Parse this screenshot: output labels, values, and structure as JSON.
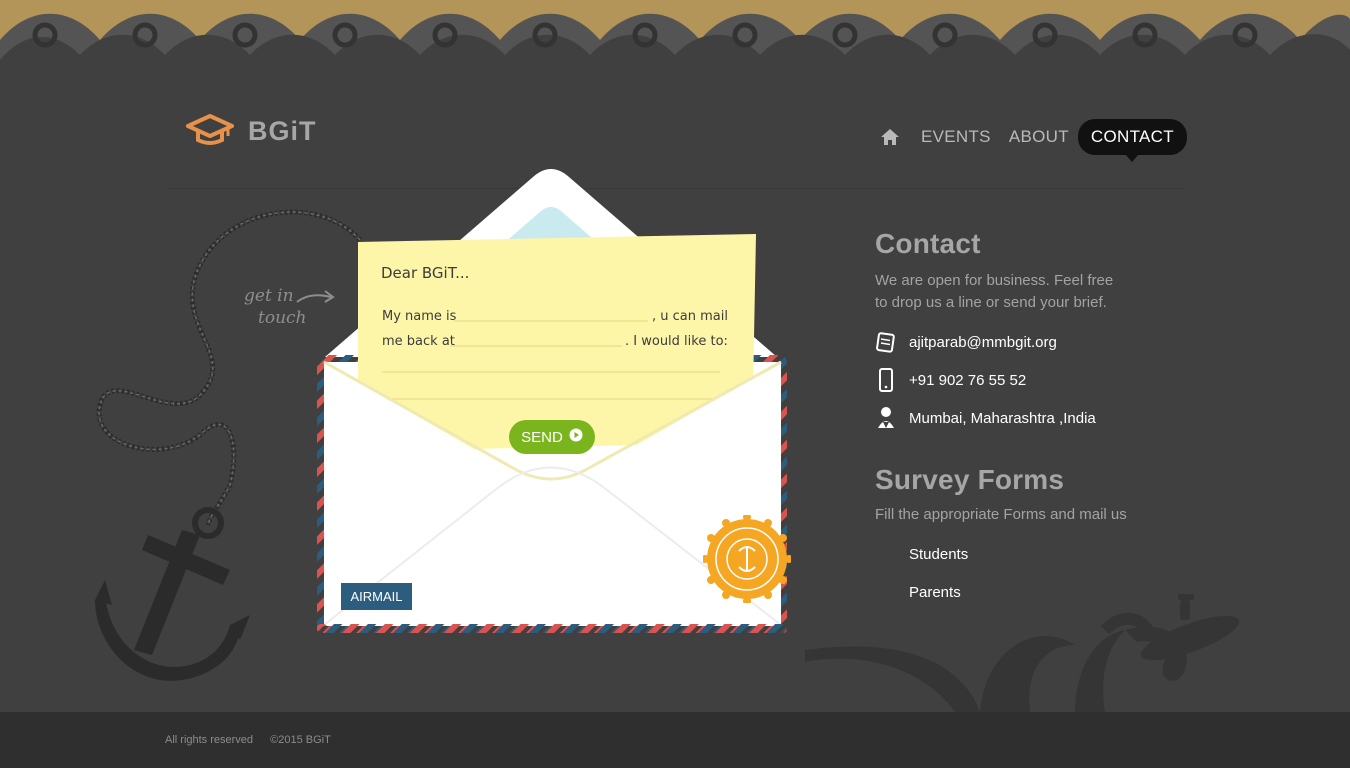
{
  "brand": {
    "name": "BGiT",
    "logo_icon": "graduation-cap-icon"
  },
  "nav": {
    "home_icon": "home-icon",
    "items": [
      {
        "label": "EVENTS",
        "active": false
      },
      {
        "label": "ABOUT",
        "active": false
      },
      {
        "label": "CONTACT",
        "active": true
      }
    ]
  },
  "decor": {
    "get_in_touch": [
      "get in",
      "touch"
    ]
  },
  "letter": {
    "greeting": "Dear BGiT...",
    "line1_a": "My name is",
    "line1_b": ", u can mail",
    "line2_a": "me back at",
    "line2_b": ". I would like to:",
    "send_label": "SEND",
    "airmail_label": "AIRMAIL"
  },
  "contact": {
    "title": "Contact",
    "description": "We are open for business. Feel free to drop us a line or send your brief.",
    "email": "ajitparab@mmbgit.org",
    "phone": "+91 902 76 55 52",
    "address": "Mumbai, Maharashtra ,India"
  },
  "survey": {
    "title": "Survey Forms",
    "description": "Fill the appropriate Forms and mail us",
    "links": [
      "Students",
      "Parents"
    ]
  },
  "footer": {
    "rights": "All rights reserved",
    "copyright": "©2015 BGiT"
  },
  "colors": {
    "background": "#404041",
    "accent_gold": "#b39459",
    "send_green": "#7ab51d",
    "airmail_blue": "#2c5d7f",
    "logo_orange": "#e8914a"
  }
}
